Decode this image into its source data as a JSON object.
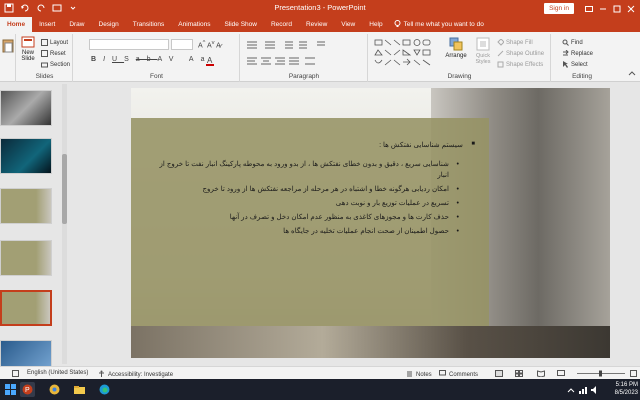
{
  "window": {
    "title": "Presentation3 - PowerPoint",
    "signin": "Sign in"
  },
  "tabs": [
    "Home",
    "Insert",
    "Draw",
    "Design",
    "Transitions",
    "Animations",
    "Slide Show",
    "Record",
    "Review",
    "View",
    "Help"
  ],
  "tell_me": "Tell me what you want to do",
  "ribbon": {
    "clipboard": {
      "paste": "Paste",
      "label": ""
    },
    "slides": {
      "new_slide": "New",
      "new_slide2": "Slide",
      "layout": "Layout",
      "reset": "Reset",
      "section": "Section",
      "label": "Slides"
    },
    "font": {
      "label": "Font"
    },
    "paragraph": {
      "label": "Paragraph"
    },
    "drawing": {
      "arrange": "Arrange",
      "quick_styles": "Quick Styles",
      "shape_fill": "Shape Fill",
      "shape_outline": "Shape Outline",
      "shape_effects": "Shape Effects",
      "label": "Drawing"
    },
    "editing": {
      "find": "Find",
      "replace": "Replace",
      "select": "Select",
      "label": "Editing"
    }
  },
  "slide": {
    "heading": "سیستم شناسایی نفتکش ها :",
    "bullets": [
      "شناسایی سریع ، دقیق و بدون خطای نفتکش ها ، از بدو ورود به محوطه پارکینگ انبار نفت تا خروج از انبار",
      "امکان ردیابی هرگونه خطا و اشتباه در هر مرحله از مراجعه نفتکش ها از ورود تا خروج",
      "تسریع در عملیات توزیع بار و نوبت دهی",
      "حذف کارت ها و مجوزهای کاغذی به منظور عدم امکان دخل و تصرف در آنها",
      "حصول اطمینان از صحت انجام عملیات تخلیه در جایگاه ها"
    ]
  },
  "status": {
    "language": "English (United States)",
    "accessibility": "Accessibility: Investigate",
    "notes": "Notes",
    "comments": "Comments"
  },
  "taskbar": {
    "time": "5:16 PM",
    "date": "8/5/2023"
  },
  "colors": {
    "accent": "#c43e1c",
    "panel": "#969364"
  }
}
